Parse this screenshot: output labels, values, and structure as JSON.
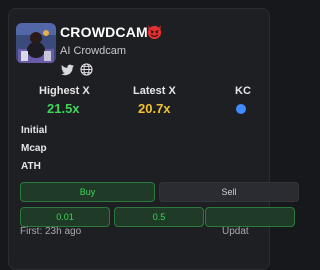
{
  "token": {
    "name": "CROWDCAM",
    "subtitle": "AI Crowdcam",
    "badge_icon": "devil-icon"
  },
  "socials": [
    "twitter-icon",
    "globe-icon"
  ],
  "stats": [
    {
      "label": "Highest X",
      "value": "21.5x",
      "color": "#3fd45a"
    },
    {
      "label": "Latest X",
      "value": "20.7x",
      "color": "#f1c232"
    },
    {
      "label": "KC",
      "value": "",
      "color": "#3f8cff"
    }
  ],
  "rows": {
    "initial": "Initial",
    "mcap": "Mcap",
    "ath": "ATH"
  },
  "actions": {
    "buy": "Buy",
    "sell": "Sell",
    "amounts": [
      "0.01",
      "0.5",
      ""
    ]
  },
  "footer": {
    "first_seen": "First: 23h ago",
    "updated": "Updat"
  },
  "colors": {
    "accent_green": "#3fd45a",
    "accent_yellow": "#f1c232",
    "background": "#17181b",
    "card": "#1e1f23"
  }
}
